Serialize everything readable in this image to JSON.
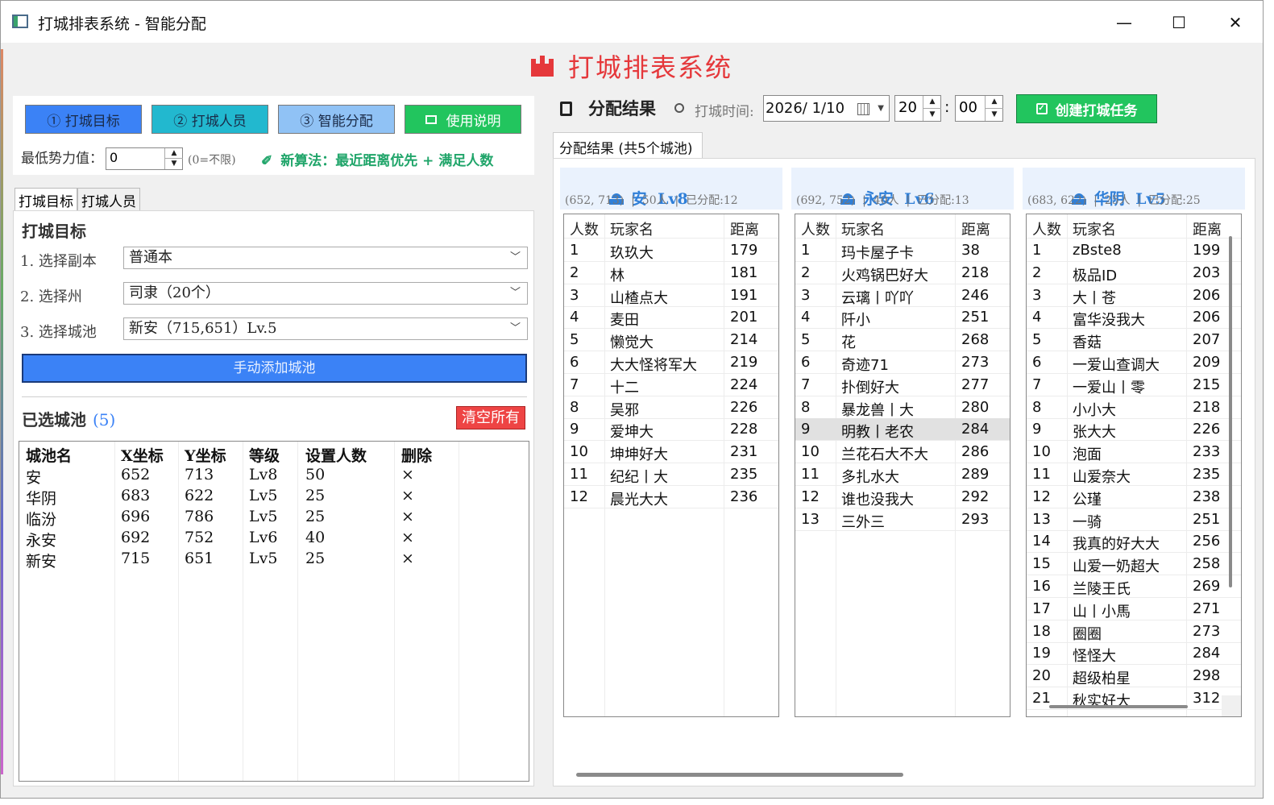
{
  "window": {
    "title": "打城排表系统 - 智能分配",
    "min_glyph": "—",
    "max_glyph": "☐",
    "close_glyph": "✕"
  },
  "banner": {
    "title": "打城排表系统"
  },
  "steps": [
    {
      "label": "① 打城目标",
      "bg": "#3b82f6"
    },
    {
      "label": "② 打城人员",
      "bg": "#22b8cf"
    },
    {
      "label": "③ 智能分配",
      "bg": "#90c2f5"
    },
    {
      "label": "使用说明",
      "bg": "#22c55e",
      "icon": "book-icon"
    }
  ],
  "min_power": {
    "label": "最低势力值：",
    "value": "0",
    "hint": "(0=不限)"
  },
  "algorithm": {
    "text": "新算法：最近距离优先 + 满足人数",
    "icon": "pin-icon"
  },
  "left_tabs": [
    "打城目标",
    "打城人员"
  ],
  "target": {
    "section_title": "打城目标",
    "rows": [
      {
        "label": "1.  选择副本",
        "value": "普通本"
      },
      {
        "label": "2.  选择州",
        "value": "司隶（20个）"
      },
      {
        "label": "3.  选择城池",
        "value": "新安（715,651）Lv.5"
      }
    ],
    "add_button": "手动添加城池"
  },
  "chosen": {
    "title": "已选城池",
    "count": "(5)",
    "clear_button": "清空所有",
    "headers": [
      "城池名",
      "X坐标",
      "Y坐标",
      "等级",
      "设置人数",
      "删除"
    ],
    "rows": [
      [
        "安",
        "652",
        "713",
        "Lv8",
        "50",
        "×"
      ],
      [
        "华阴",
        "683",
        "622",
        "Lv5",
        "25",
        "×"
      ],
      [
        "临汾",
        "696",
        "786",
        "Lv5",
        "25",
        "×"
      ],
      [
        "永安",
        "692",
        "752",
        "Lv6",
        "40",
        "×"
      ],
      [
        "新安",
        "715",
        "651",
        "Lv5",
        "25",
        "×"
      ]
    ]
  },
  "result": {
    "title": "分配结果",
    "time_label": "打城时间:",
    "date": "2026/  1/10",
    "hour": "20",
    "minute": "00",
    "create_button": "创建打城任务",
    "tab": "分配结果 (共5个城池)",
    "list_headers": [
      "人数",
      "玩家名",
      "距离"
    ],
    "cities": [
      {
        "title": "安  Lv8",
        "sub": "(652, 713)  |  50人  |  已分配:12",
        "selected_row": -1,
        "players": [
          [
            "1",
            "玖玖大",
            "179"
          ],
          [
            "2",
            "林",
            "181"
          ],
          [
            "3",
            "山楂点大",
            "191"
          ],
          [
            "4",
            "麦田",
            "201"
          ],
          [
            "5",
            "懒觉大",
            "214"
          ],
          [
            "6",
            "大大怪将军大",
            "219"
          ],
          [
            "7",
            "十二",
            "224"
          ],
          [
            "8",
            "吴邪",
            "226"
          ],
          [
            "9",
            "爱坤大",
            "228"
          ],
          [
            "10",
            "坤坤好大",
            "231"
          ],
          [
            "11",
            "纪纪丨大",
            "235"
          ],
          [
            "12",
            "晨光大大",
            "236"
          ]
        ]
      },
      {
        "title": "永安  Lv6",
        "sub": "(692, 752)  |  40人  |  已分配:13",
        "selected_row": 8,
        "players": [
          [
            "1",
            "玛卡屋子卡",
            "38"
          ],
          [
            "2",
            "火鸡锅巴好大",
            "218"
          ],
          [
            "3",
            "云璃丨吖吖",
            "246"
          ],
          [
            "4",
            "阡小",
            "251"
          ],
          [
            "5",
            "花",
            "268"
          ],
          [
            "6",
            "奇迹71",
            "273"
          ],
          [
            "7",
            "扑倒好大",
            "277"
          ],
          [
            "8",
            "暴龙兽丨大",
            "280"
          ],
          [
            "9",
            "明教丨老农",
            "284"
          ],
          [
            "10",
            "兰花石大不大",
            "286"
          ],
          [
            "11",
            "多扎水大",
            "289"
          ],
          [
            "12",
            "谁也没我大",
            "292"
          ],
          [
            "13",
            "三外三",
            "293"
          ]
        ]
      },
      {
        "title": "华阴  Lv5",
        "sub": "(683, 622)  |  25人  |  已分配:25",
        "selected_row": -1,
        "players": [
          [
            "1",
            "zBste8",
            "199"
          ],
          [
            "2",
            "极品ID",
            "203"
          ],
          [
            "3",
            "大丨苍",
            "206"
          ],
          [
            "4",
            "富华没我大",
            "206"
          ],
          [
            "5",
            "香菇",
            "207"
          ],
          [
            "6",
            "一爱山查调大",
            "209"
          ],
          [
            "7",
            "一爱山丨零",
            "215"
          ],
          [
            "8",
            "小小大",
            "218"
          ],
          [
            "9",
            "张大大",
            "226"
          ],
          [
            "10",
            "泡面",
            "233"
          ],
          [
            "11",
            "山爱奈大",
            "235"
          ],
          [
            "12",
            "公瑾",
            "238"
          ],
          [
            "13",
            "一骑",
            "251"
          ],
          [
            "14",
            "我真的好大大",
            "256"
          ],
          [
            "15",
            "山爱一奶超大",
            "258"
          ],
          [
            "16",
            "兰陵王氏",
            "269"
          ],
          [
            "17",
            "山丨小馬",
            "271"
          ],
          [
            "18",
            "圈圈",
            "273"
          ],
          [
            "19",
            "怪怪大",
            "284"
          ],
          [
            "20",
            "超级柏星",
            "298"
          ],
          [
            "21",
            "秋实好大",
            "312"
          ]
        ]
      }
    ]
  }
}
